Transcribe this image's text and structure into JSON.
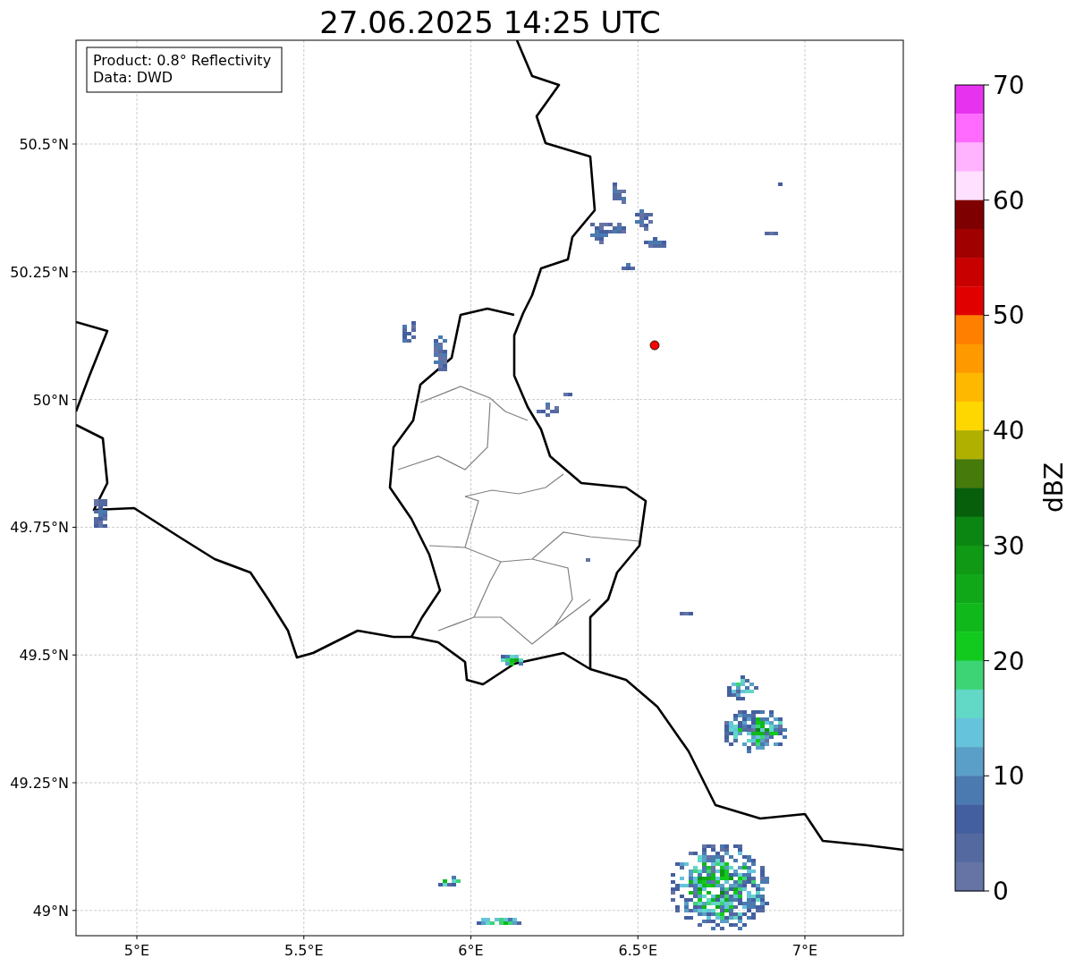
{
  "title": "27.06.2025 14:25 UTC",
  "info_box": [
    "Product: 0.8° Reflectivity",
    "Data: DWD"
  ],
  "map": {
    "y_tick_labels": [
      "50.5°N",
      "50.25°N",
      "50°N",
      "49.75°N",
      "49.5°N",
      "49.25°N",
      "49°N"
    ],
    "x_tick_labels": [
      "5°E",
      "5.5°E",
      "6°E",
      "6.5°E",
      "7°E"
    ]
  },
  "colorbar": {
    "label": "dBZ",
    "ticks": [
      "70",
      "60",
      "50",
      "40",
      "30",
      "20",
      "10",
      "0"
    ],
    "bins": [
      {
        "color": "#e733f0"
      },
      {
        "color": "#ff6aff"
      },
      {
        "color": "#ffb3ff"
      },
      {
        "color": "#ffe0ff"
      },
      {
        "color": "#7e0000"
      },
      {
        "color": "#a00000"
      },
      {
        "color": "#c80000"
      },
      {
        "color": "#e00000"
      },
      {
        "color": "#ff7f00"
      },
      {
        "color": "#ff9900"
      },
      {
        "color": "#ffb800"
      },
      {
        "color": "#ffd700"
      },
      {
        "color": "#b0b000"
      },
      {
        "color": "#467a0a"
      },
      {
        "color": "#075f0c"
      },
      {
        "color": "#0c8612"
      },
      {
        "color": "#0f9914"
      },
      {
        "color": "#10a818"
      },
      {
        "color": "#10b81c"
      },
      {
        "color": "#12c91e"
      },
      {
        "color": "#3dd475"
      },
      {
        "color": "#62d8c6"
      },
      {
        "color": "#66c3dc"
      },
      {
        "color": "#5a9fc7"
      },
      {
        "color": "#4a7ab0"
      },
      {
        "color": "#445fa0"
      },
      {
        "color": "#5469a0"
      },
      {
        "color": "#6573a5"
      }
    ]
  }
}
